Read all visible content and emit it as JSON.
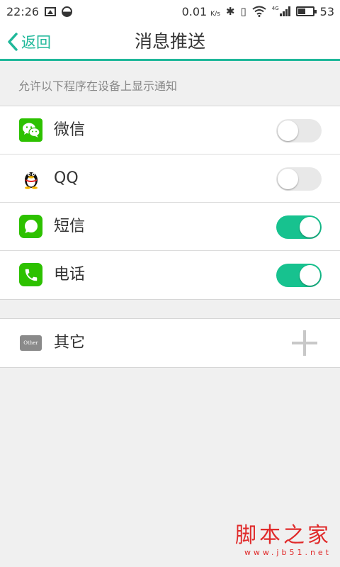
{
  "status_bar": {
    "time": "22:26",
    "net_speed": "0.01",
    "net_unit": "K/s",
    "network_type": "4G",
    "battery": "53",
    "battery_level": 0.53
  },
  "header": {
    "back_label": "返回",
    "title": "消息推送"
  },
  "section_caption": "允许以下程序在设备上显示通知",
  "apps": [
    {
      "label": "微信",
      "icon": "wechat-icon",
      "enabled": false
    },
    {
      "label": "QQ",
      "icon": "qq-icon",
      "enabled": false
    },
    {
      "label": "短信",
      "icon": "sms-icon",
      "enabled": true
    },
    {
      "label": "电话",
      "icon": "phone-icon",
      "enabled": true
    }
  ],
  "other": {
    "label": "其它",
    "icon_text": "Other"
  },
  "watermark": {
    "main": "脚本之家",
    "sub": "www.jb51.net"
  },
  "colors": {
    "accent": "#1fb89a",
    "toggle_on": "#17c28f",
    "toggle_off": "#e8e8e8",
    "wechat_green": "#2dc100",
    "watermark": "#e02a2a"
  }
}
